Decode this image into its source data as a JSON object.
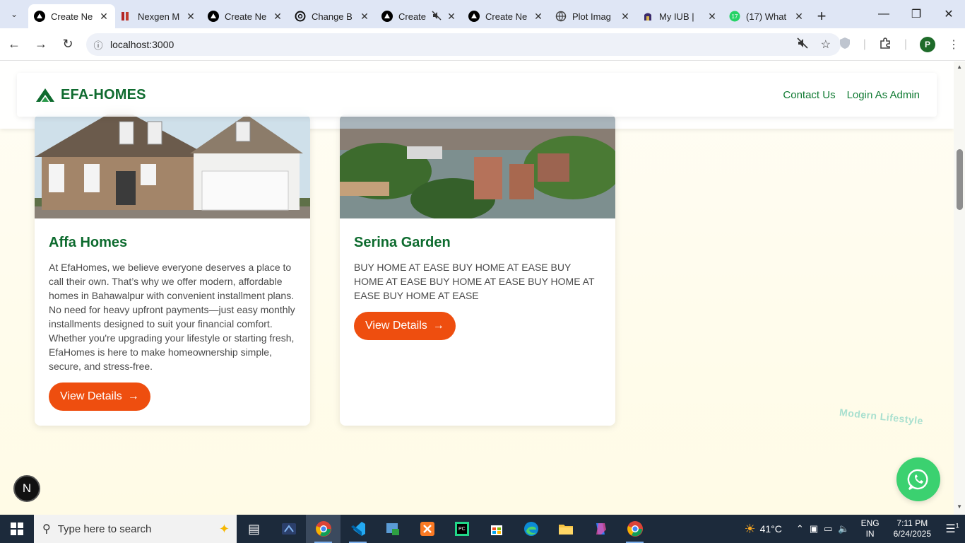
{
  "browser": {
    "tabs": [
      {
        "title": "Create Ne",
        "favicon": "triangle-icon",
        "active": true
      },
      {
        "title": "Nexgen M",
        "favicon": "nexgen-icon",
        "active": false
      },
      {
        "title": "Create Ne",
        "favicon": "triangle-icon",
        "active": false
      },
      {
        "title": "Change B",
        "favicon": "openai-icon",
        "active": false
      },
      {
        "title": "Create",
        "favicon": "triangle-icon",
        "active": false,
        "muted": true
      },
      {
        "title": "Create Ne",
        "favicon": "triangle-icon",
        "active": false
      },
      {
        "title": "Plot Imag",
        "favicon": "globe-icon",
        "active": false
      },
      {
        "title": "My IUB |",
        "favicon": "iub-icon",
        "active": false
      },
      {
        "title": "(17) What",
        "favicon": "whatsapp-icon",
        "active": false
      }
    ],
    "url": "localhost:3000",
    "profile_initial": "P"
  },
  "site": {
    "logo_text": "EFA-HOMES",
    "nav": {
      "contact": "Contact Us",
      "admin": "Login As Admin"
    },
    "brand_color": "#0f6b2f",
    "accent_color": "#ee4e0f"
  },
  "cards": [
    {
      "title": "Affa Homes",
      "description": "At EfaHomes, we believe everyone deserves a place to call their own. That’s why we offer modern, affordable homes in Bahawalpur with convenient installment plans. No need for heavy upfront payments—just easy monthly installments designed to suit your financial comfort. Whether you're upgrading your lifestyle or starting fresh, EfaHomes is here to make homeownership simple, secure, and stress-free.",
      "button": "View Details"
    },
    {
      "title": "Serina Garden",
      "description": "BUY HOME AT EASE BUY HOME AT EASE BUY HOME AT EASE BUY HOME AT EASE BUY HOME AT EASE BUY HOME AT EASE",
      "button": "View Details"
    }
  ],
  "decor": {
    "modern_lifestyle": "Modern Lifestyle",
    "next_badge": "N"
  },
  "taskbar": {
    "search_placeholder": "Type here to search",
    "temperature": "41°C",
    "lang_line1": "ENG",
    "lang_line2": "IN",
    "time": "7:11 PM",
    "date": "6/24/2025",
    "notification_count": "1"
  }
}
